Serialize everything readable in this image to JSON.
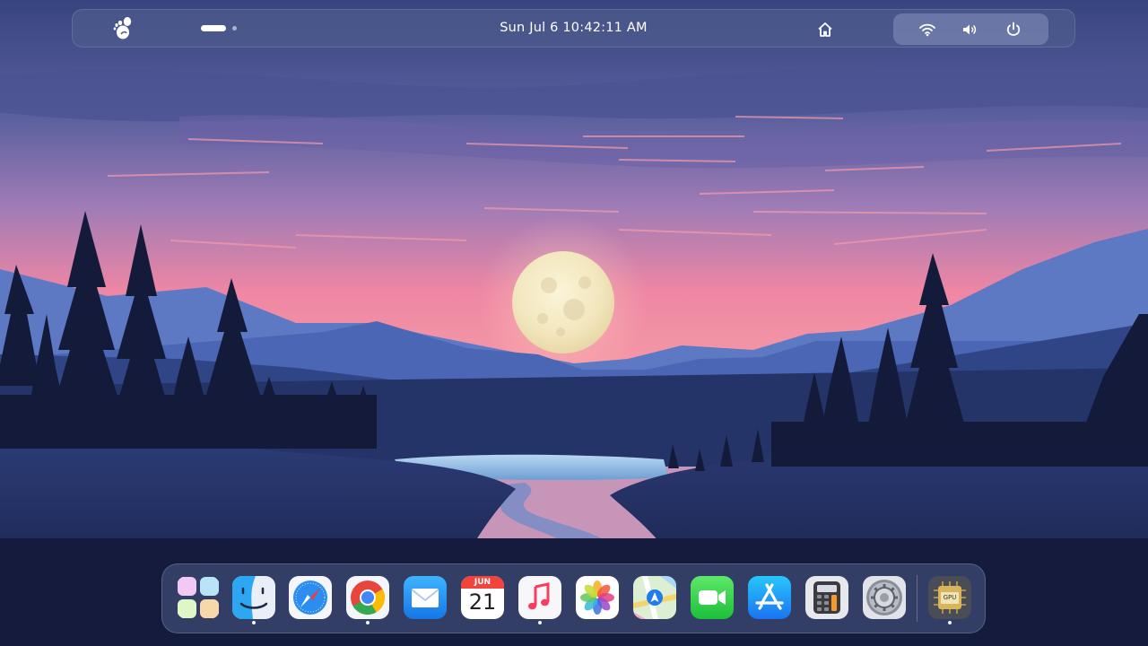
{
  "topbar": {
    "activities_icon": "gnome-foot-icon",
    "workspaces": {
      "count": 2,
      "active_index": 0
    },
    "datetime": "Sun Jul 6  10:42:11 AM",
    "home_icon": "home-icon",
    "tray": {
      "icons": [
        "wifi-icon",
        "volume-icon",
        "power-icon"
      ]
    }
  },
  "dock": {
    "apps": [
      {
        "name": "Launchpad",
        "icon": "launchpad-grid-icon",
        "running": false
      },
      {
        "name": "Finder",
        "icon": "finder-icon",
        "running": true
      },
      {
        "name": "Safari",
        "icon": "safari-compass-icon",
        "running": false
      },
      {
        "name": "Chrome",
        "icon": "chrome-icon",
        "running": true
      },
      {
        "name": "Mail",
        "icon": "mail-envelope-icon",
        "running": false
      },
      {
        "name": "Calendar",
        "icon": "calendar-icon",
        "running": false,
        "month": "JUN",
        "day": "21"
      },
      {
        "name": "Music",
        "icon": "music-note-icon",
        "running": true
      },
      {
        "name": "Photos",
        "icon": "photos-flower-icon",
        "running": false
      },
      {
        "name": "Maps",
        "icon": "maps-icon",
        "running": false
      },
      {
        "name": "FaceTime",
        "icon": "facetime-camera-icon",
        "running": false
      },
      {
        "name": "App Store",
        "icon": "app-store-icon",
        "running": false
      },
      {
        "name": "Calculator",
        "icon": "calculator-icon",
        "running": false
      },
      {
        "name": "System Settings",
        "icon": "settings-gear-icon",
        "running": false
      },
      {
        "name": "GPU",
        "icon": "gpu-chip-icon",
        "running": true,
        "label": "GPU"
      }
    ]
  },
  "colors": {
    "sky_top": "#3d4a8a",
    "sky_mid": "#8a78b8",
    "sky_glow": "#f28ba3",
    "moon": "#f5ecc8",
    "land": "#1e2a58"
  }
}
